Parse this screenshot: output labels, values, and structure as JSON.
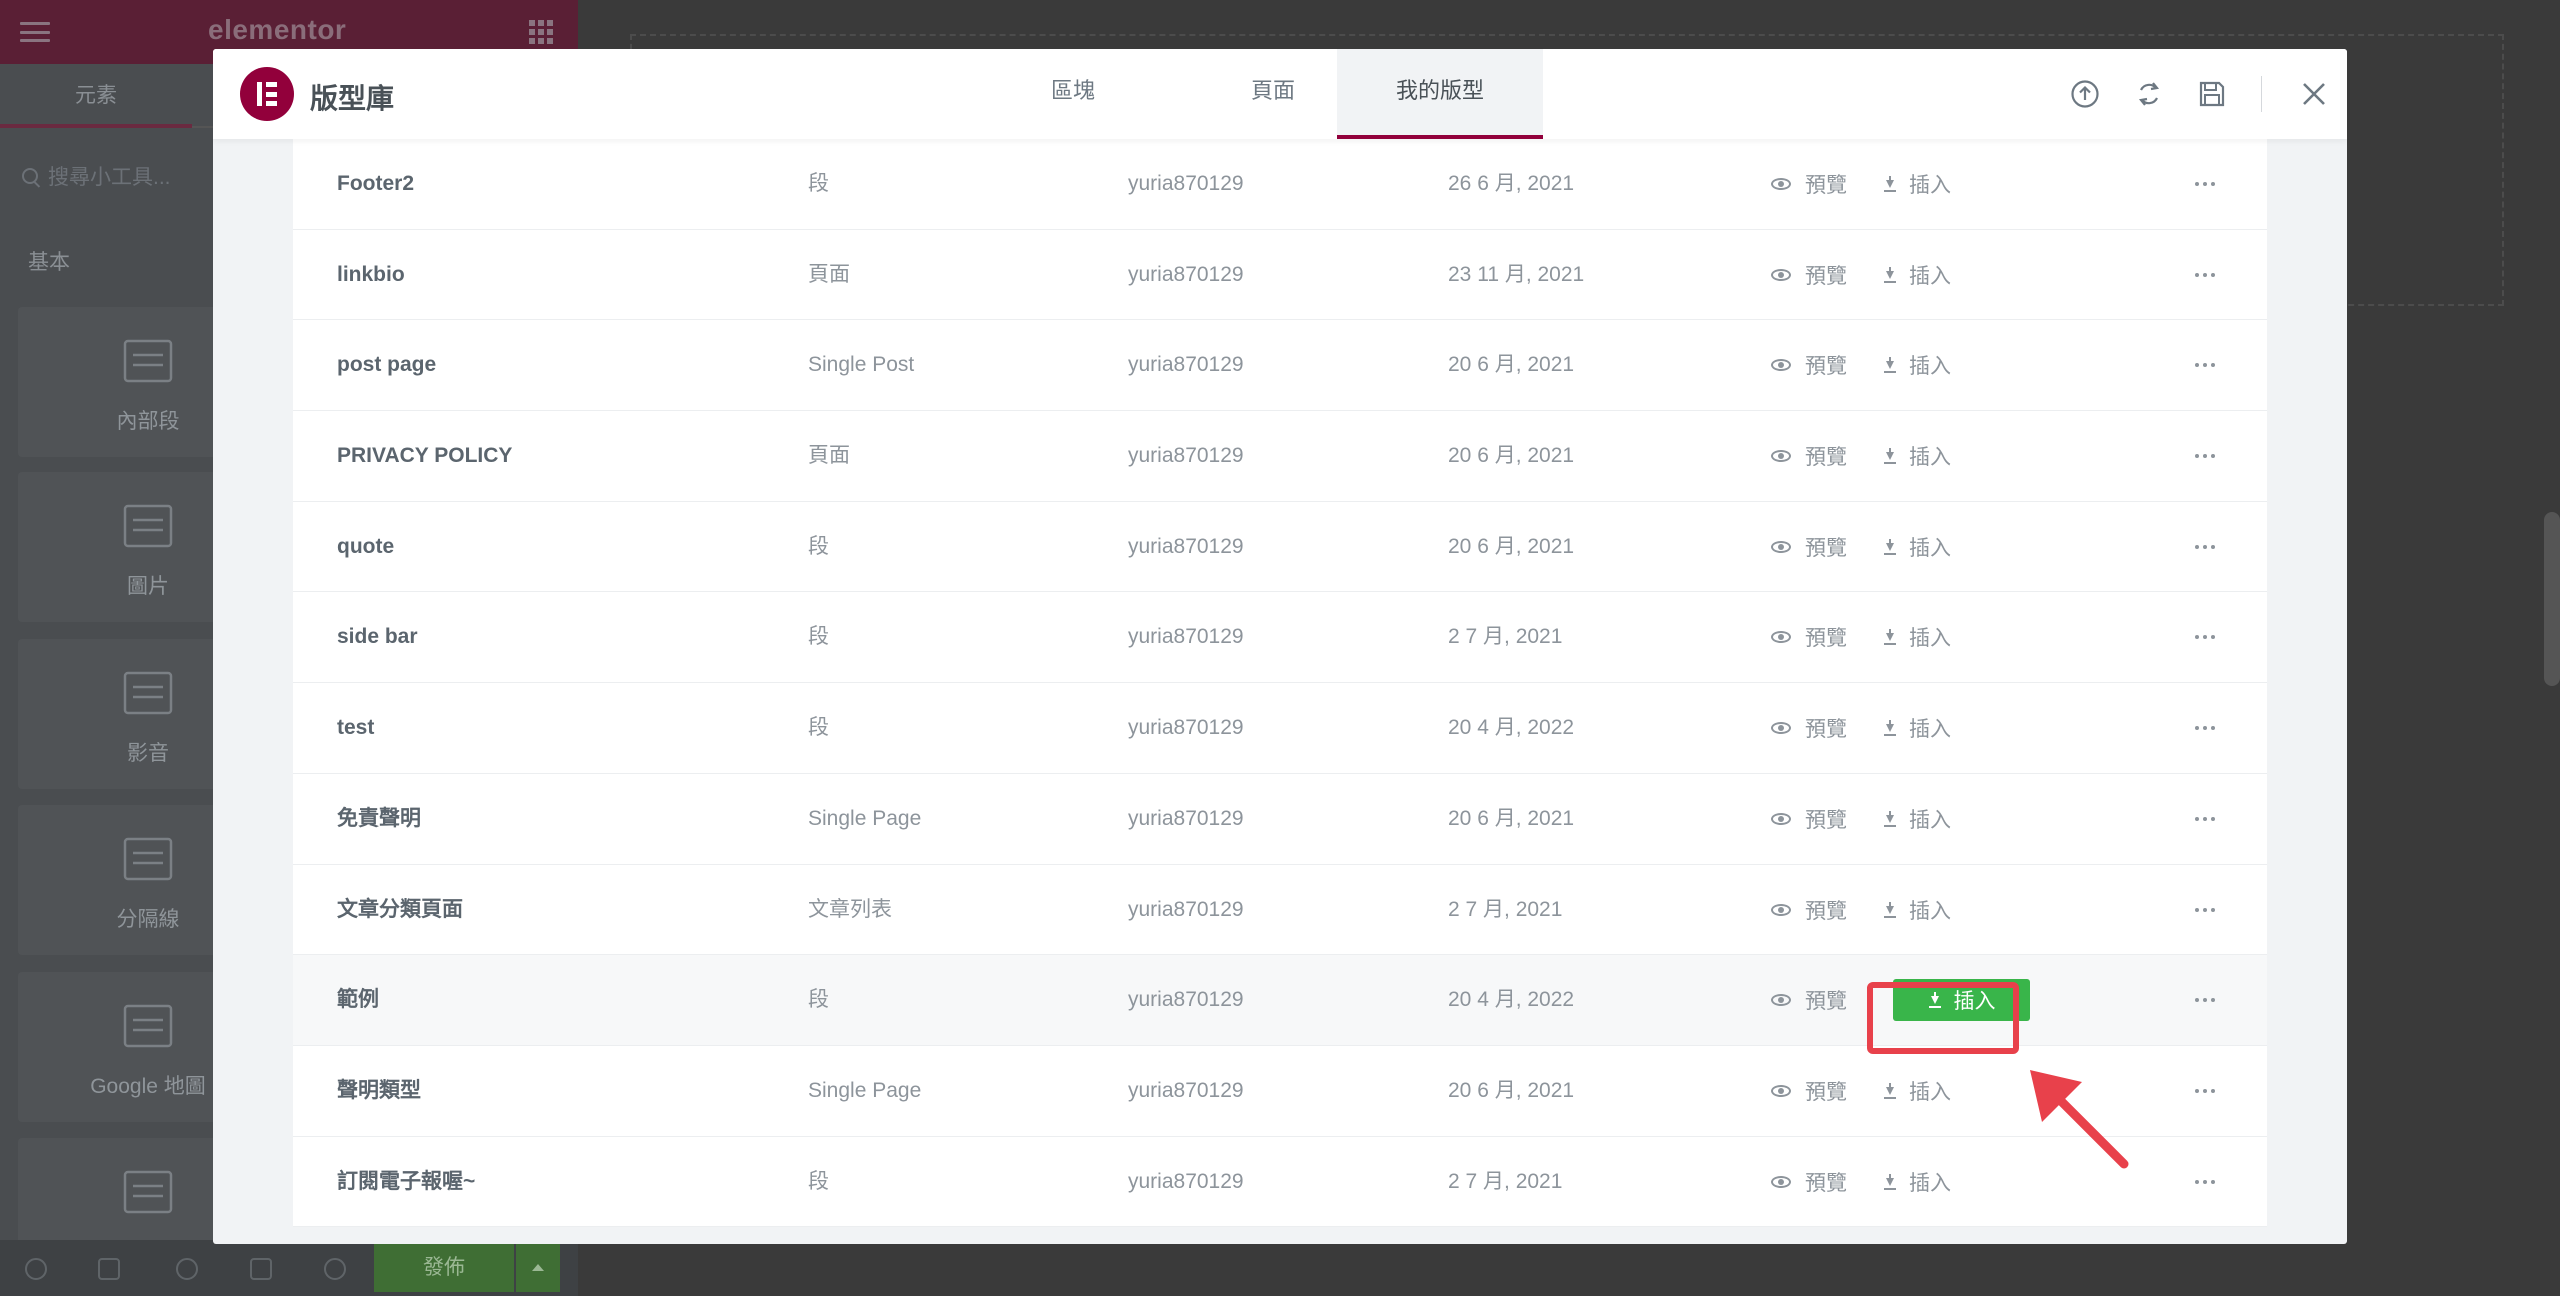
{
  "editor": {
    "logo": "elementor",
    "tab_elements": "元素",
    "search_placeholder": "搜尋小工具...",
    "section_basic": "基本",
    "widgets": [
      {
        "label": "內部段",
        "icon": "inner-section-icon"
      },
      {
        "label": "圖片",
        "icon": "image-icon"
      },
      {
        "label": "影音",
        "icon": "video-icon"
      },
      {
        "label": "分隔線",
        "icon": "divider-icon"
      },
      {
        "label": "Google 地圖",
        "icon": "map-icon"
      },
      {
        "label": "",
        "icon": "text-editor-icon"
      }
    ],
    "publish_label": "發佈"
  },
  "modal": {
    "title": "版型庫",
    "tabs": [
      {
        "label": "區塊",
        "active": false
      },
      {
        "label": "頁面",
        "active": false
      },
      {
        "label": "我的版型",
        "active": true
      }
    ],
    "header_icons": [
      "import-icon",
      "sync-icon",
      "save-icon",
      "close-icon"
    ],
    "accent_color": "#92003b",
    "insert_color": "#39b54a",
    "highlight_color": "#e8414b"
  },
  "templates": [
    {
      "title": "Footer2",
      "type": "段",
      "author": "yuria870129",
      "date": "26 6 月, 2021",
      "preview": "預覽",
      "insert": "插入"
    },
    {
      "title": "linkbio",
      "type": "頁面",
      "author": "yuria870129",
      "date": "23 11 月, 2021",
      "preview": "預覽",
      "insert": "插入"
    },
    {
      "title": "post page",
      "type": "Single Post",
      "author": "yuria870129",
      "date": "20 6 月, 2021",
      "preview": "預覽",
      "insert": "插入"
    },
    {
      "title": "PRIVACY POLICY",
      "type": "頁面",
      "author": "yuria870129",
      "date": "20 6 月, 2021",
      "preview": "預覽",
      "insert": "插入"
    },
    {
      "title": "quote",
      "type": "段",
      "author": "yuria870129",
      "date": "20 6 月, 2021",
      "preview": "預覽",
      "insert": "插入"
    },
    {
      "title": "side bar",
      "type": "段",
      "author": "yuria870129",
      "date": "2 7 月, 2021",
      "preview": "預覽",
      "insert": "插入"
    },
    {
      "title": "test",
      "type": "段",
      "author": "yuria870129",
      "date": "20 4 月, 2022",
      "preview": "預覽",
      "insert": "插入"
    },
    {
      "title": "免責聲明",
      "type": "Single Page",
      "author": "yuria870129",
      "date": "20 6 月, 2021",
      "preview": "預覽",
      "insert": "插入"
    },
    {
      "title": "文章分類頁面",
      "type": "文章列表",
      "author": "yuria870129",
      "date": "2 7 月, 2021",
      "preview": "預覽",
      "insert": "插入"
    },
    {
      "title": "範例",
      "type": "段",
      "author": "yuria870129",
      "date": "20 4 月, 2022",
      "preview": "預覽",
      "insert": "插入",
      "hovered": true
    },
    {
      "title": "聲明類型",
      "type": "Single Page",
      "author": "yuria870129",
      "date": "20 6 月, 2021",
      "preview": "預覽",
      "insert": "插入"
    },
    {
      "title": "訂閱電子報喔~",
      "type": "段",
      "author": "yuria870129",
      "date": "2 7 月, 2021",
      "preview": "預覽",
      "insert": "插入"
    }
  ]
}
